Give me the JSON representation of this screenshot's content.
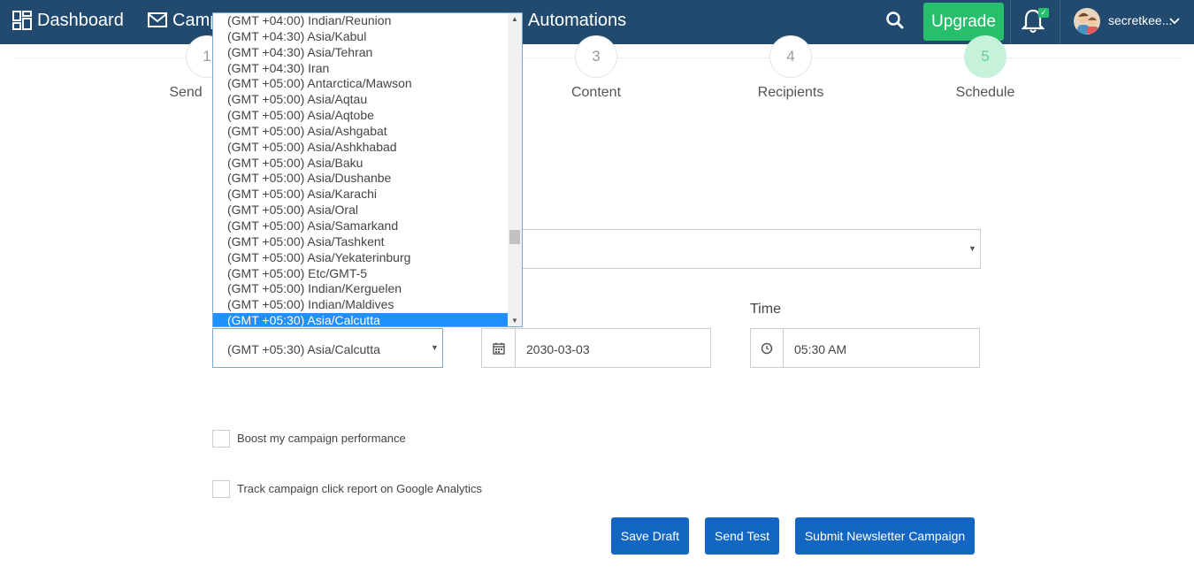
{
  "nav": {
    "dashboard": "Dashboard",
    "campaigns_partial": "Camp",
    "automations": "Automations",
    "upgrade": "Upgrade",
    "username": "secretkee..."
  },
  "steps": [
    {
      "number": "1",
      "label": "Send"
    },
    {
      "number": "3",
      "label": "Content"
    },
    {
      "number": "4",
      "label": "Recipients"
    },
    {
      "number": "5",
      "label": "Schedule"
    }
  ],
  "timezone_dropdown": {
    "options": [
      "(GMT +04:00) Indian/Reunion",
      "(GMT +04:30) Asia/Kabul",
      "(GMT +04:30) Asia/Tehran",
      "(GMT +04:30) Iran",
      "(GMT +05:00) Antarctica/Mawson",
      "(GMT +05:00) Asia/Aqtau",
      "(GMT +05:00) Asia/Aqtobe",
      "(GMT +05:00) Asia/Ashgabat",
      "(GMT +05:00) Asia/Ashkhabad",
      "(GMT +05:00) Asia/Baku",
      "(GMT +05:00) Asia/Dushanbe",
      "(GMT +05:00) Asia/Karachi",
      "(GMT +05:00) Asia/Oral",
      "(GMT +05:00) Asia/Samarkand",
      "(GMT +05:00) Asia/Tashkent",
      "(GMT +05:00) Asia/Yekaterinburg",
      "(GMT +05:00) Etc/GMT-5",
      "(GMT +05:00) Indian/Kerguelen",
      "(GMT +05:00) Indian/Maldives",
      "(GMT +05:30) Asia/Calcutta"
    ],
    "selected": "(GMT +05:30) Asia/Calcutta"
  },
  "schedule": {
    "timezone_value": "(GMT +05:30) Asia/Calcutta",
    "date_value": "2030-03-03",
    "time_label": "Time",
    "time_value": "05:30 AM"
  },
  "options": {
    "boost": "Boost my campaign performance",
    "track": "Track campaign click report on Google Analytics"
  },
  "buttons": {
    "save_draft": "Save Draft",
    "send_test": "Send Test",
    "submit": "Submit Newsletter Campaign"
  },
  "colors": {
    "topbar": "#214a6e",
    "upgrade": "#27bf6c",
    "primary_button": "#1366c2",
    "selected_option": "#1e90ff",
    "active_step": "#c6f2dc"
  }
}
